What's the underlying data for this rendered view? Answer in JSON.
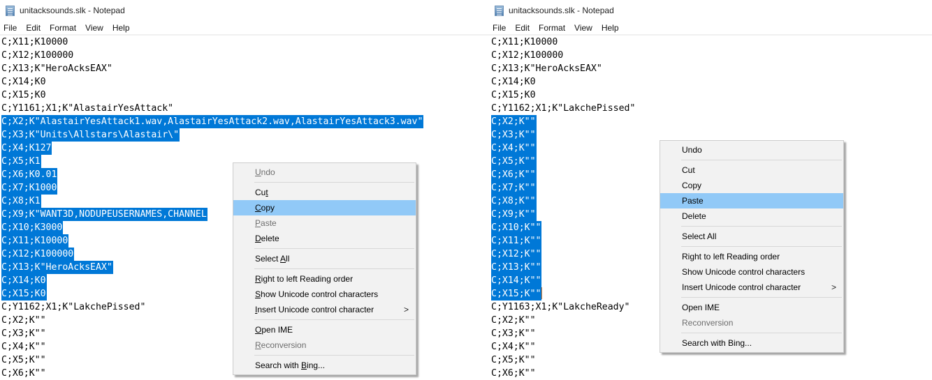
{
  "windows": [
    {
      "title": "unitacksounds.slk - Notepad",
      "menu": [
        "File",
        "Edit",
        "Format",
        "View",
        "Help"
      ],
      "lines": [
        {
          "text": "C;X11;K10000",
          "selected": false
        },
        {
          "text": "C;X12;K100000",
          "selected": false
        },
        {
          "text": "C;X13;K\"HeroAcksEAX\"",
          "selected": false
        },
        {
          "text": "C;X14;K0",
          "selected": false
        },
        {
          "text": "C;X15;K0",
          "selected": false
        },
        {
          "text": "C;Y1161;X1;K\"AlastairYesAttack\"",
          "selected": false
        },
        {
          "text": "C;X2;K\"AlastairYesAttack1.wav,AlastairYesAttack2.wav,AlastairYesAttack3.wav\"",
          "selected": true
        },
        {
          "text": "C;X3;K\"Units\\Allstars\\Alastair\\\"",
          "selected": true
        },
        {
          "text": "C;X4;K127",
          "selected": true
        },
        {
          "text": "C;X5;K1",
          "selected": true
        },
        {
          "text": "C;X6;K0.01",
          "selected": true
        },
        {
          "text": "C;X7;K1000",
          "selected": true
        },
        {
          "text": "C;X8;K1",
          "selected": true
        },
        {
          "text": "C;X9;K\"WANT3D,NODUPEUSERNAMES,CHANNEL",
          "selected": true
        },
        {
          "text": "C;X10;K3000",
          "selected": true
        },
        {
          "text": "C;X11;K10000",
          "selected": true
        },
        {
          "text": "C;X12;K100000",
          "selected": true
        },
        {
          "text": "C;X13;K\"HeroAcksEAX\"",
          "selected": true
        },
        {
          "text": "C;X14;K0",
          "selected": true
        },
        {
          "text": "C;X15;K0",
          "selected": true
        },
        {
          "text": "C;Y1162;X1;K\"LakchePissed\"",
          "selected": false
        },
        {
          "text": "C;X2;K\"\"",
          "selected": false
        },
        {
          "text": "C;X3;K\"\"",
          "selected": false
        },
        {
          "text": "C;X4;K\"\"",
          "selected": false
        },
        {
          "text": "C;X5;K\"\"",
          "selected": false
        },
        {
          "text": "C;X6;K\"\"",
          "selected": false
        }
      ],
      "context_menu": {
        "items": [
          {
            "label": "Undo",
            "underline": "U",
            "disabled": true
          },
          {
            "sep": true
          },
          {
            "label": "Cut",
            "underline": "t",
            "disabled": false
          },
          {
            "label": "Copy",
            "underline": "C",
            "disabled": false,
            "highlighted": true
          },
          {
            "label": "Paste",
            "underline": "P",
            "disabled": true
          },
          {
            "label": "Delete",
            "underline": "D",
            "disabled": false
          },
          {
            "sep": true
          },
          {
            "label": "Select All",
            "underline": "A",
            "disabled": false
          },
          {
            "sep": true
          },
          {
            "label": "Right to left Reading order",
            "underline": "R",
            "disabled": false
          },
          {
            "label": "Show Unicode control characters",
            "underline": "S",
            "disabled": false
          },
          {
            "label": "Insert Unicode control character",
            "underline": "I",
            "disabled": false,
            "submenu": true
          },
          {
            "sep": true
          },
          {
            "label": "Open IME",
            "underline": "O",
            "disabled": false
          },
          {
            "label": "Reconversion",
            "underline": "R",
            "disabled": true
          },
          {
            "sep": true
          },
          {
            "label": "Search with Bing...",
            "underline": "B",
            "disabled": false
          }
        ]
      }
    },
    {
      "title": "unitacksounds.slk - Notepad",
      "menu": [
        "File",
        "Edit",
        "Format",
        "View",
        "Help"
      ],
      "lines": [
        {
          "text": "C;X11;K10000",
          "selected": false
        },
        {
          "text": "C;X12;K100000",
          "selected": false
        },
        {
          "text": "C;X13;K\"HeroAcksEAX\"",
          "selected": false
        },
        {
          "text": "C;X14;K0",
          "selected": false
        },
        {
          "text": "C;X15;K0",
          "selected": false
        },
        {
          "text": "C;Y1162;X1;K\"LakchePissed\"",
          "selected": false
        },
        {
          "text": "C;X2;K\"\"",
          "selected": true
        },
        {
          "text": "C;X3;K\"\"",
          "selected": true
        },
        {
          "text": "C;X4;K\"\"",
          "selected": true
        },
        {
          "text": "C;X5;K\"\"",
          "selected": true
        },
        {
          "text": "C;X6;K\"\"",
          "selected": true
        },
        {
          "text": "C;X7;K\"\"",
          "selected": true
        },
        {
          "text": "C;X8;K\"\"",
          "selected": true
        },
        {
          "text": "C;X9;K\"\"",
          "selected": true
        },
        {
          "text": "C;X10;K\"\"",
          "selected": true
        },
        {
          "text": "C;X11;K\"\"",
          "selected": true
        },
        {
          "text": "C;X12;K\"\"",
          "selected": true
        },
        {
          "text": "C;X13;K\"\"",
          "selected": true
        },
        {
          "text": "C;X14;K\"\"",
          "selected": true
        },
        {
          "text": "C;X15;K\"\"",
          "selected": true,
          "caret": true
        },
        {
          "text": "C;Y1163;X1;K\"LakcheReady\"",
          "selected": false
        },
        {
          "text": "C;X2;K\"\"",
          "selected": false
        },
        {
          "text": "C;X3;K\"\"",
          "selected": false
        },
        {
          "text": "C;X4;K\"\"",
          "selected": false
        },
        {
          "text": "C;X5;K\"\"",
          "selected": false
        },
        {
          "text": "C;X6;K\"\"",
          "selected": false
        }
      ],
      "context_menu": {
        "items": [
          {
            "label": "Undo",
            "disabled": false
          },
          {
            "sep": true
          },
          {
            "label": "Cut",
            "disabled": false
          },
          {
            "label": "Copy",
            "disabled": false
          },
          {
            "label": "Paste",
            "disabled": false,
            "highlighted": true
          },
          {
            "label": "Delete",
            "disabled": false
          },
          {
            "sep": true
          },
          {
            "label": "Select All",
            "disabled": false
          },
          {
            "sep": true
          },
          {
            "label": "Right to left Reading order",
            "disabled": false
          },
          {
            "label": "Show Unicode control characters",
            "disabled": false
          },
          {
            "label": "Insert Unicode control character",
            "disabled": false,
            "submenu": true
          },
          {
            "sep": true
          },
          {
            "label": "Open IME",
            "disabled": false
          },
          {
            "label": "Reconversion",
            "disabled": true
          },
          {
            "sep": true
          },
          {
            "label": "Search with Bing...",
            "disabled": false
          }
        ]
      }
    }
  ],
  "icons": {
    "app": "notepad-icon",
    "submenu": "chevron-right-icon",
    "submenu_glyph": ">"
  }
}
